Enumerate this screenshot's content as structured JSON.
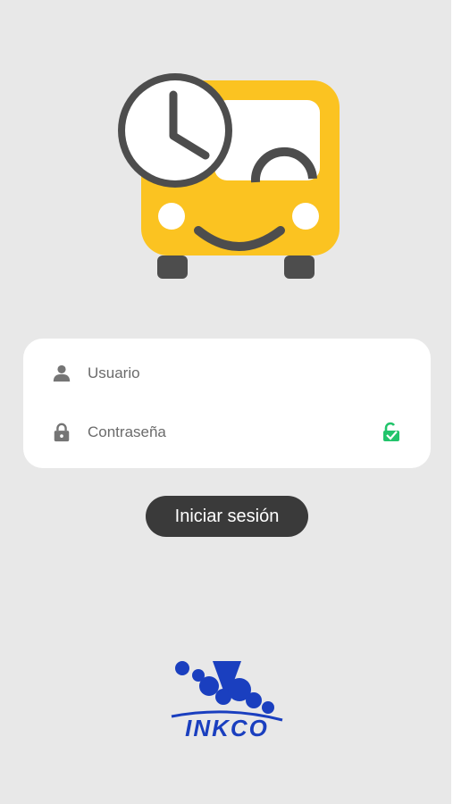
{
  "login": {
    "username": {
      "placeholder": "Usuario",
      "value": "",
      "icon": "person-icon"
    },
    "password": {
      "placeholder": "Contraseña",
      "value": "",
      "icon": "lock-icon",
      "toggle_icon": "unlock-icon"
    },
    "submit_label": "Iniciar sesión"
  },
  "app_logo": {
    "icon": "bus-clock-icon"
  },
  "company": {
    "name": "INKCO"
  },
  "colors": {
    "background": "#e8e8e8",
    "card": "#ffffff",
    "bus_yellow": "#fbc321",
    "dark_gray": "#4d4d4d",
    "button": "#3a3a3a",
    "toggle_green": "#22c46b",
    "brand_blue": "#1a3fbf"
  }
}
